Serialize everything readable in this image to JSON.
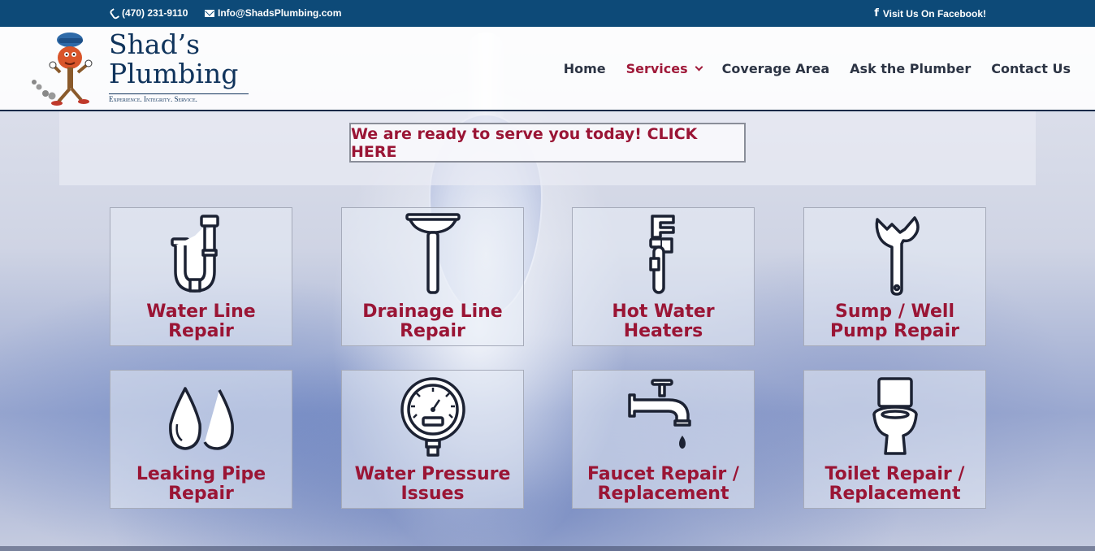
{
  "topbar": {
    "phone": "(470) 231-9110",
    "email": "Info@ShadsPlumbing.com",
    "facebook": "Visit Us On Facebook!",
    "phone_icon": "phone-icon",
    "email_icon": "envelope-icon",
    "facebook_icon": "facebook-icon"
  },
  "logo": {
    "line1": "Shad’s",
    "line2": "Plumbing",
    "tagline": "Experience. Integrity. Service."
  },
  "nav": {
    "items": [
      {
        "label": "Home"
      },
      {
        "label": "Services"
      },
      {
        "label": "Coverage Area"
      },
      {
        "label": "Ask the Plumber"
      },
      {
        "label": "Contact Us"
      }
    ],
    "active": "Services"
  },
  "cta": {
    "label": "We are ready to serve you today! CLICK HERE"
  },
  "services": [
    {
      "line1": "Water Line",
      "line2": "Repair",
      "icon": "pipe-icon"
    },
    {
      "line1": "Drainage Line",
      "line2": "Repair",
      "icon": "plunger-icon"
    },
    {
      "line1": "Hot Water",
      "line2": "Heaters",
      "icon": "pipe-wrench-icon"
    },
    {
      "line1": "Sump / Well",
      "line2": "Pump Repair",
      "icon": "wrench-icon"
    },
    {
      "line1": "Leaking Pipe",
      "line2": "Repair",
      "icon": "water-drops-icon"
    },
    {
      "line1": "Water Pressure",
      "line2": "Issues",
      "icon": "pressure-gauge-icon"
    },
    {
      "line1": "Faucet Repair /",
      "line2": "Replacement",
      "icon": "faucet-icon"
    },
    {
      "line1": "Toilet Repair /",
      "line2": "Replacement",
      "icon": "toilet-icon"
    }
  ],
  "colors": {
    "topbar": "#0d4a78",
    "accent": "#9a1535",
    "nav_text": "#2c3444",
    "logo_blue": "#10345c"
  }
}
